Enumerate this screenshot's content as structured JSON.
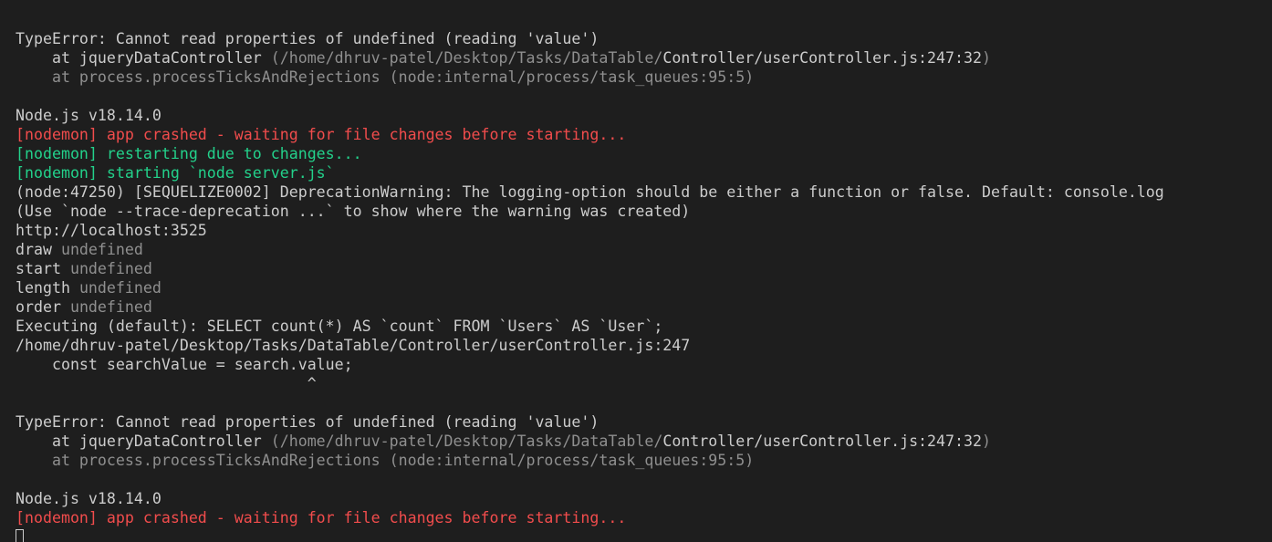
{
  "terminal": {
    "colors": {
      "background": "#1e1e1e",
      "foreground": "#cccccc",
      "dim": "#8f8f8f",
      "error": "#f14c4c",
      "success": "#23d18b"
    },
    "lines": [
      {
        "segments": [
          {
            "text": "                    ^",
            "style": "bright"
          }
        ]
      },
      {
        "segments": [
          {
            "text": "",
            "style": "bright"
          }
        ]
      },
      {
        "segments": [
          {
            "text": "TypeError: Cannot read properties of undefined (reading 'value')",
            "style": "bright"
          }
        ]
      },
      {
        "segments": [
          {
            "text": "    at jqueryDataController ",
            "style": "bright"
          },
          {
            "text": "(/home/dhruv-patel/Desktop/Tasks/DataTable/",
            "style": "dim"
          },
          {
            "text": "Controller/userController.js:247:32",
            "style": "bright"
          },
          {
            "text": ")",
            "style": "dim"
          }
        ]
      },
      {
        "segments": [
          {
            "text": "    at process.processTicksAndRejections (node:internal/process/task_queues:95:5)",
            "style": "dim"
          }
        ]
      },
      {
        "segments": [
          {
            "text": "",
            "style": "bright"
          }
        ]
      },
      {
        "segments": [
          {
            "text": "Node.js v18.14.0",
            "style": "bright"
          }
        ]
      },
      {
        "segments": [
          {
            "text": "[nodemon] app crashed - waiting for file changes before starting...",
            "style": "red"
          }
        ]
      },
      {
        "segments": [
          {
            "text": "[nodemon] restarting due to changes...",
            "style": "green"
          }
        ]
      },
      {
        "segments": [
          {
            "text": "[nodemon] starting `node server.js`",
            "style": "green"
          }
        ]
      },
      {
        "segments": [
          {
            "text": "(node:47250) [SEQUELIZE0002] DeprecationWarning: The logging-option should be either a function or false. Default: console.log",
            "style": "bright"
          }
        ]
      },
      {
        "segments": [
          {
            "text": "(Use `node --trace-deprecation ...` to show where the warning was created)",
            "style": "bright"
          }
        ]
      },
      {
        "segments": [
          {
            "text": "http://localhost:3525",
            "style": "bright"
          }
        ]
      },
      {
        "segments": [
          {
            "text": "draw ",
            "style": "bright"
          },
          {
            "text": "undefined",
            "style": "dim"
          }
        ]
      },
      {
        "segments": [
          {
            "text": "start ",
            "style": "bright"
          },
          {
            "text": "undefined",
            "style": "dim"
          }
        ]
      },
      {
        "segments": [
          {
            "text": "length ",
            "style": "bright"
          },
          {
            "text": "undefined",
            "style": "dim"
          }
        ]
      },
      {
        "segments": [
          {
            "text": "order ",
            "style": "bright"
          },
          {
            "text": "undefined",
            "style": "dim"
          }
        ]
      },
      {
        "segments": [
          {
            "text": "Executing (default): SELECT count(*) AS `count` FROM `Users` AS `User`;",
            "style": "bright"
          }
        ]
      },
      {
        "segments": [
          {
            "text": "/home/dhruv-patel/Desktop/Tasks/DataTable/Controller/userController.js:247",
            "style": "bright"
          }
        ]
      },
      {
        "segments": [
          {
            "text": "    const searchValue = search.value;",
            "style": "bright"
          }
        ]
      },
      {
        "segments": [
          {
            "text": "                                ^",
            "style": "bright"
          }
        ]
      },
      {
        "segments": [
          {
            "text": "",
            "style": "bright"
          }
        ]
      },
      {
        "segments": [
          {
            "text": "TypeError: Cannot read properties of undefined (reading 'value')",
            "style": "bright"
          }
        ]
      },
      {
        "segments": [
          {
            "text": "    at jqueryDataController ",
            "style": "bright"
          },
          {
            "text": "(/home/dhruv-patel/Desktop/Tasks/DataTable/",
            "style": "dim"
          },
          {
            "text": "Controller/userController.js:247:32",
            "style": "bright"
          },
          {
            "text": ")",
            "style": "dim"
          }
        ]
      },
      {
        "segments": [
          {
            "text": "    at process.processTicksAndRejections (node:internal/process/task_queues:95:5)",
            "style": "dim"
          }
        ]
      },
      {
        "segments": [
          {
            "text": "",
            "style": "bright"
          }
        ]
      },
      {
        "segments": [
          {
            "text": "Node.js v18.14.0",
            "style": "bright"
          }
        ]
      },
      {
        "segments": [
          {
            "text": "[nodemon] app crashed - waiting for file changes before starting...",
            "style": "red"
          }
        ]
      }
    ]
  }
}
